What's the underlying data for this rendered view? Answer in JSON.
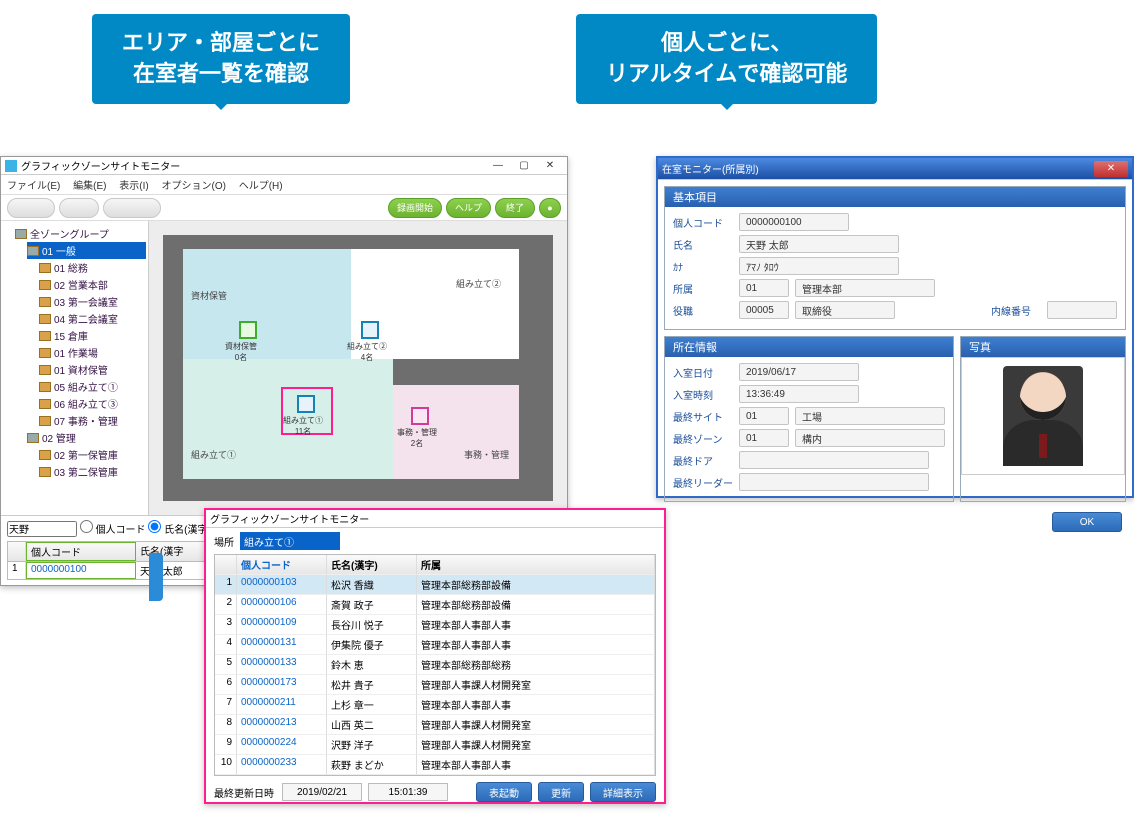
{
  "callouts": {
    "left_line1": "エリア・部屋ごとに",
    "left_line2": "在室者一覧を確認",
    "right_line1": "個人ごとに、",
    "right_line2": "リアルタイムで確認可能"
  },
  "left_window": {
    "title": "グラフィックゾーンサイトモニター",
    "menu": {
      "file": "ファイル(E)",
      "edit": "編集(E)",
      "view": "表示(I)",
      "option": "オプション(O)",
      "help": "ヘルプ(H)"
    },
    "toolbar": {
      "rec": "録画開始",
      "help": "ヘルプ",
      "exit": "終了"
    },
    "tree": {
      "root": "全ゾーングループ",
      "g1": "01 一般",
      "g1_items": [
        "01 総務",
        "02 営業本部",
        "03 第一会議室",
        "04 第二会議室",
        "15 倉庫",
        "01 作業場",
        "01 資材保管",
        "05 組み立て①",
        "06 組み立て③",
        "07 事務・管理"
      ],
      "g2": "02 管理",
      "g2_items": [
        "02 第一保管庫",
        "03 第二保管庫"
      ]
    },
    "rooms": {
      "a": "資材保管",
      "b": "組み立て②",
      "c": "組み立て①",
      "d": "事務・管理"
    },
    "nodes": {
      "n1": "資材保管",
      "n1s": "0名",
      "n2": "組み立て②",
      "n2s": "4名",
      "n3": "組み立て①",
      "n3s": "11名",
      "n4": "事務・管理",
      "n4s": "2名"
    },
    "search": {
      "value": "天野",
      "radio_code": "個人コード",
      "radio_name": "氏名(漢字",
      "col_code": "個人コード",
      "col_name": "氏名(漢字",
      "row_code": "0000000100",
      "row_name": "天野 太郎"
    }
  },
  "popup": {
    "title": "グラフィックゾーンサイトモニター",
    "loc_label": "場所",
    "loc_value": "組み立て①",
    "cols": {
      "idx": "",
      "code": "個人コード",
      "name": "氏名(漢字)",
      "dept": "所属"
    },
    "rows": [
      {
        "i": "1",
        "code": "0000000103",
        "name": "松沢 香織",
        "dept": "管理本部総務部設備"
      },
      {
        "i": "2",
        "code": "0000000106",
        "name": "斎賀 政子",
        "dept": "管理本部総務部設備"
      },
      {
        "i": "3",
        "code": "0000000109",
        "name": "長谷川 悦子",
        "dept": "管理本部人事部人事"
      },
      {
        "i": "4",
        "code": "0000000131",
        "name": "伊集院 優子",
        "dept": "管理本部人事部人事"
      },
      {
        "i": "5",
        "code": "0000000133",
        "name": "鈴木 恵",
        "dept": "管理本部総務部総務"
      },
      {
        "i": "6",
        "code": "0000000173",
        "name": "松井 貴子",
        "dept": "管理部人事課人材開発室"
      },
      {
        "i": "7",
        "code": "0000000211",
        "name": "上杉 章一",
        "dept": "管理本部人事部人事"
      },
      {
        "i": "8",
        "code": "0000000213",
        "name": "山西 英二",
        "dept": "管理部人事課人材開発室"
      },
      {
        "i": "9",
        "code": "0000000224",
        "name": "沢野 洋子",
        "dept": "管理部人事課人材開発室"
      },
      {
        "i": "10",
        "code": "0000000233",
        "name": "萩野 まどか",
        "dept": "管理本部人事部人事"
      }
    ],
    "footer": {
      "label": "最終更新日時",
      "date": "2019/02/21",
      "time": "15:01:39",
      "btn1": "表起動",
      "btn2": "更新",
      "btn3": "詳細表示"
    }
  },
  "right_window": {
    "title": "在室モニター(所属別)",
    "sec1_title": "基本項目",
    "sec2_title": "所在情報",
    "photo_title": "写真",
    "labels": {
      "code": "個人コード",
      "name": "氏名",
      "kana": "ｶﾅ",
      "dept": "所属",
      "post": "役職",
      "ext": "内線番号",
      "in_date": "入室日付",
      "in_time": "入室時刻",
      "last_site": "最終サイト",
      "last_zone": "最終ゾーン",
      "last_door": "最終ドア",
      "last_reader": "最終リーダー",
      "ok": "OK"
    },
    "values": {
      "code": "0000000100",
      "name": "天野 太郎",
      "kana": "ｱﾏﾉ ﾀﾛｳ",
      "dept_code": "01",
      "dept_name": "管理本部",
      "post_code": "00005",
      "post_name": "取締役",
      "in_date": "2019/06/17",
      "in_time": "13:36:49",
      "site_code": "01",
      "site_name": "工場",
      "zone_code": "01",
      "zone_name": "構内"
    }
  }
}
